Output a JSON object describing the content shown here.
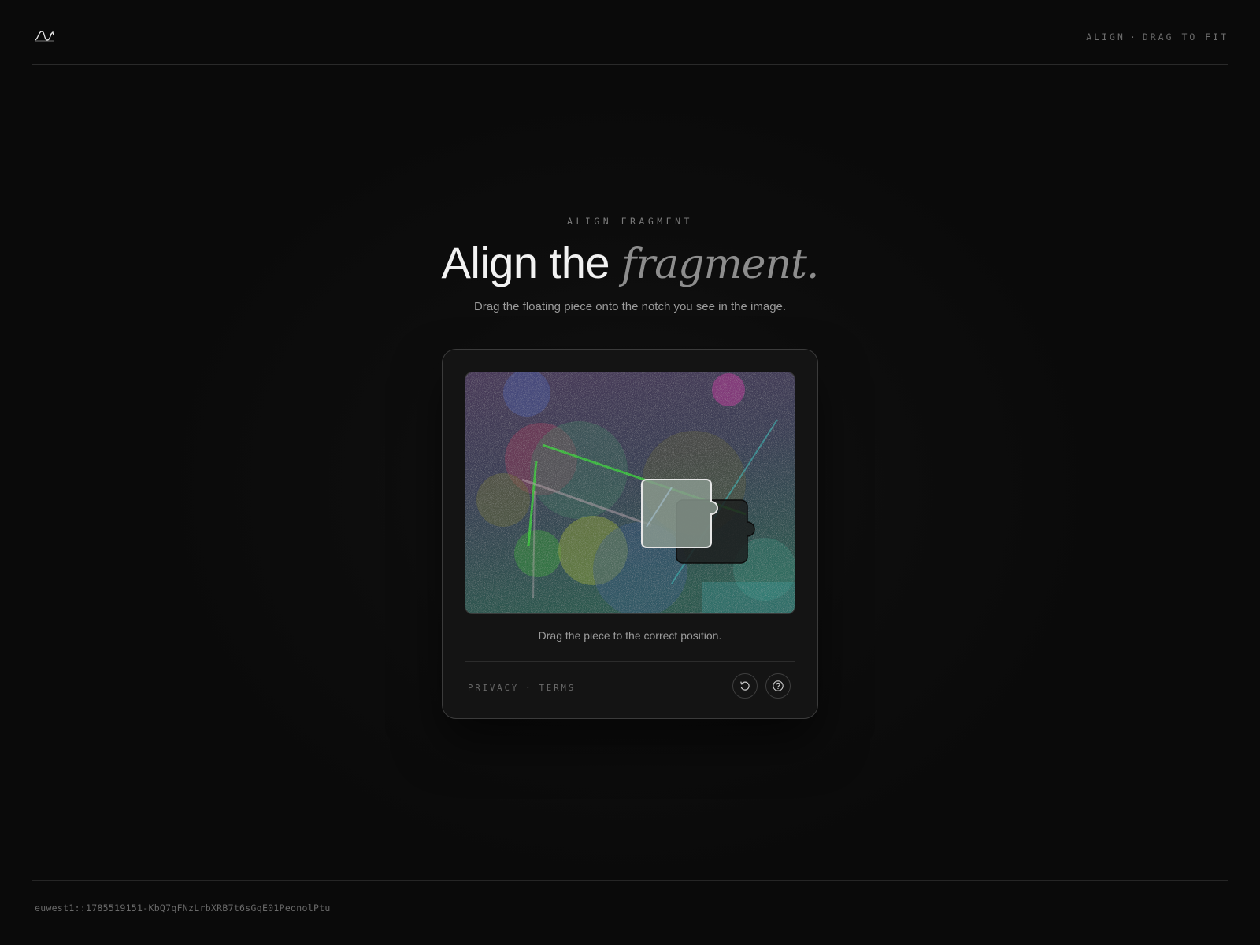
{
  "header": {
    "logo_icon": "wave-logo-icon",
    "status_left": "ALIGN",
    "status_sep": "·",
    "status_right": "DRAG TO FIT"
  },
  "main": {
    "eyebrow": "ALIGN FRAGMENT",
    "title_plain": "Align the ",
    "title_emphasis": "fragment.",
    "subtitle": "Drag the floating piece onto the notch you see in the image."
  },
  "captcha": {
    "hint": "Drag the piece to the correct position.",
    "links": {
      "privacy": "PRIVACY",
      "sep": "·",
      "terms": "TERMS"
    },
    "refresh_icon": "refresh-icon",
    "help_icon": "help-circle-icon"
  },
  "footer": {
    "session_id": "euwest1::1785519151-KbQ7qFNzLrbXRB7t6sGqE01PeonolPtu"
  }
}
